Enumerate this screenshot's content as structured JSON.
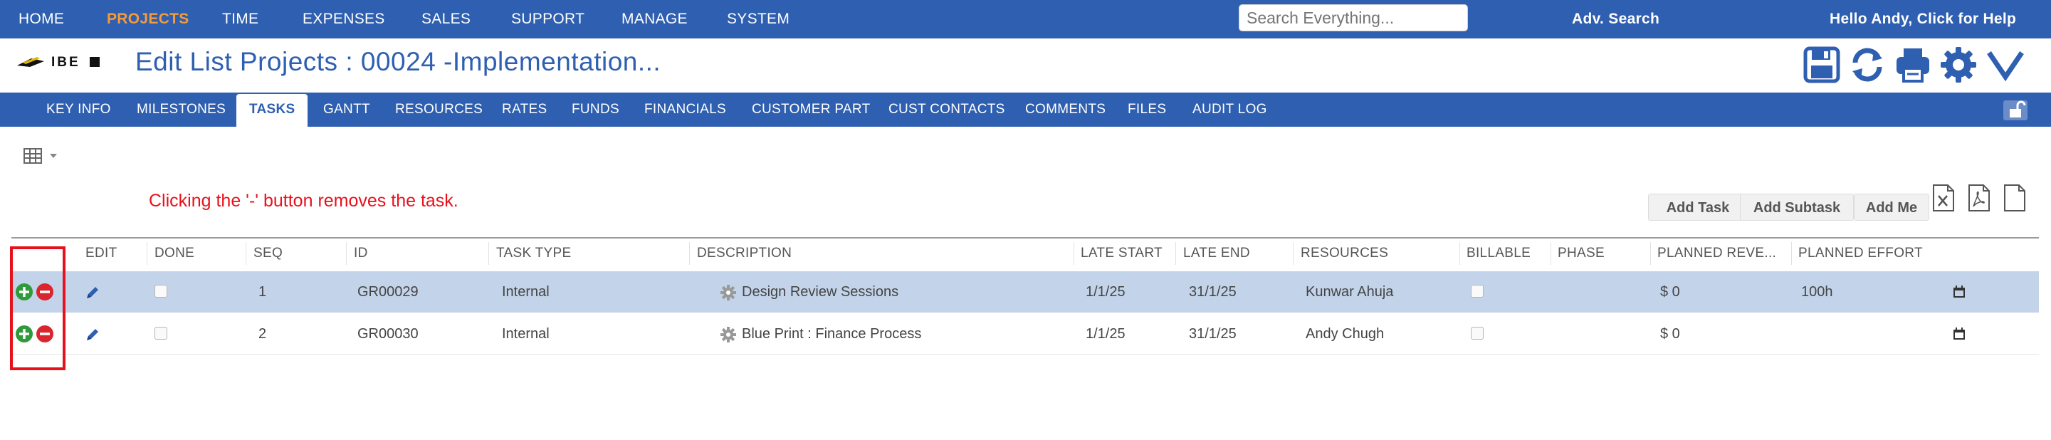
{
  "nav": {
    "items": [
      "HOME",
      "PROJECTS",
      "TIME",
      "EXPENSES",
      "SALES",
      "SUPPORT",
      "MANAGE",
      "SYSTEM"
    ],
    "active": "PROJECTS",
    "search_placeholder": "Search Everything...",
    "adv_search": "Adv. Search",
    "greeting": "Hello Andy, Click for Help"
  },
  "header": {
    "logo_text": "IBE",
    "title": "Edit List Projects : 00024 -Implementation...",
    "toolbar_icons": [
      "save-icon",
      "refresh-icon",
      "print-icon",
      "gear-icon",
      "chevron-down-icon"
    ]
  },
  "tabs": [
    "KEY INFO",
    "MILESTONES",
    "TASKS",
    "GANTT",
    "RESOURCES",
    "RATES",
    "FUNDS",
    "FINANCIALS",
    "CUSTOMER PART",
    "CUST CONTACTS",
    "COMMENTS",
    "FILES",
    "AUDIT LOG"
  ],
  "active_tab": "TASKS",
  "note": "Clicking the '-' button removes the task.",
  "buttons": {
    "add_task": "Add Task",
    "add_subtask": "Add Subtask",
    "add_me": "Add Me"
  },
  "export_icons": [
    "excel-export-icon",
    "pdf-export-icon",
    "file-export-icon"
  ],
  "table": {
    "columns": [
      "EDIT",
      "DONE",
      "SEQ",
      "ID",
      "TASK TYPE",
      "DESCRIPTION",
      "LATE START",
      "LATE END",
      "RESOURCES",
      "BILLABLE",
      "PHASE",
      "PLANNED REVE...",
      "PLANNED EFFORT"
    ],
    "rows": [
      {
        "seq": "1",
        "id": "GR00029",
        "task_type": "Internal",
        "description": "Design Review Sessions",
        "late_start": "1/1/25",
        "late_end": "31/1/25",
        "resources": "Kunwar Ahuja",
        "planned_revenue": "$ 0",
        "planned_effort": "100h",
        "selected": true
      },
      {
        "seq": "2",
        "id": "GR00030",
        "task_type": "Internal",
        "description": "Blue Print : Finance Process",
        "late_start": "1/1/25",
        "late_end": "31/1/25",
        "resources": "Andy Chugh",
        "planned_revenue": "$ 0",
        "planned_effort": "",
        "selected": false
      }
    ]
  },
  "colors": {
    "primary": "#2e5fb0",
    "active_nav": "#f49b3b",
    "selected_row": "#c3d4ea",
    "note": "#e8111b",
    "add": "#2e9a3a",
    "remove": "#d9262e"
  }
}
